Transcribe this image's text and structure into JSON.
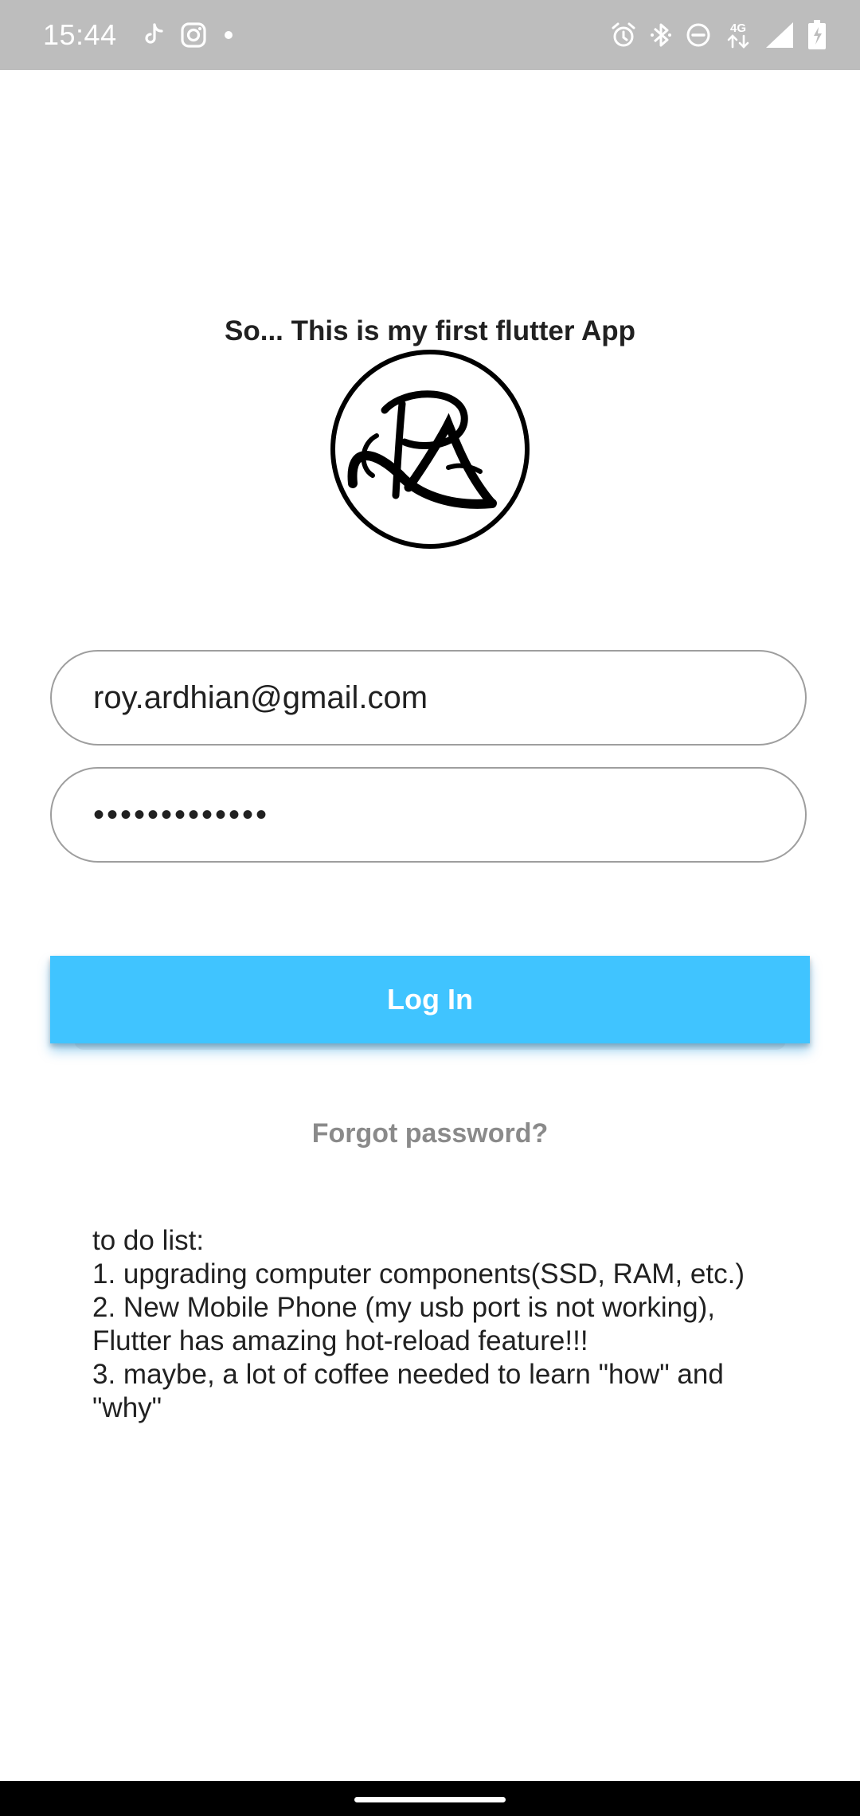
{
  "status_bar": {
    "time": "15:44",
    "left_icons": [
      "tiktok-icon",
      "instagram-icon",
      "dot-icon"
    ],
    "right_icons": [
      "alarm-icon",
      "bluetooth-icon",
      "do-not-disturb-icon",
      "network-4g-icon",
      "signal-icon",
      "battery-charging-icon"
    ],
    "network_label": "4G",
    "background_color": "#bdbdbd"
  },
  "header": {
    "title": "So... This is my first flutter App"
  },
  "login_form": {
    "email_value": "roy.ardhian@gmail.com",
    "password_value": "•••••••••••••",
    "login_label": "Log In",
    "login_color": "#40c4ff",
    "forgot_label": "Forgot password?"
  },
  "todo": {
    "lines": [
      "to do list:",
      "1. upgrading computer components(SSD, RAM, etc.)",
      "2. New Mobile Phone (my usb port is not working),",
      "Flutter has amazing hot-reload feature!!!",
      "3. maybe, a lot of coffee needed to learn \"how\" and",
      "\"why\""
    ]
  }
}
